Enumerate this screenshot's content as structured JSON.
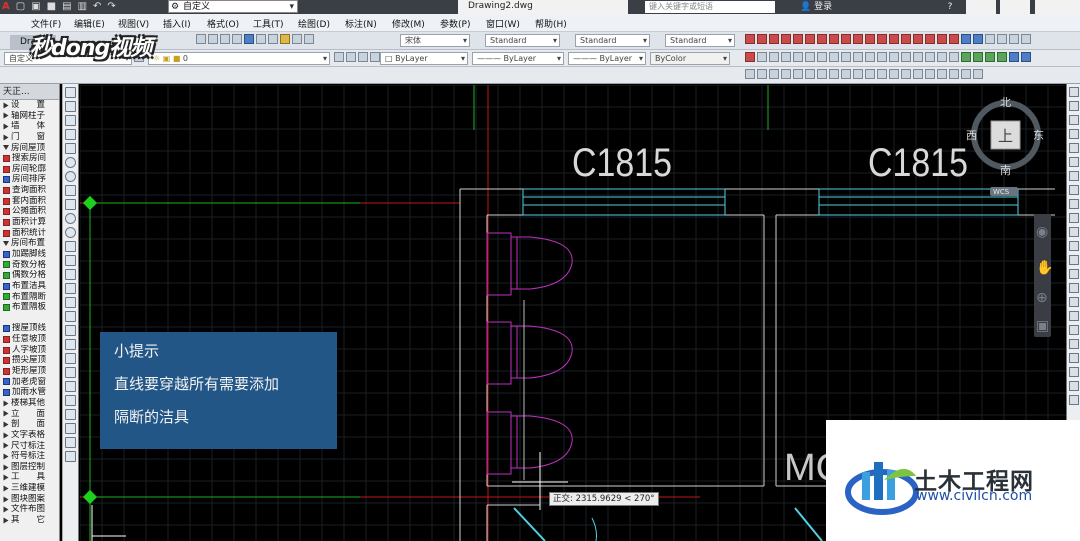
{
  "titlebar": {
    "workspace": "自定义",
    "filename": "Drawing2.dwg",
    "search_placeholder": "键入关键字或短语",
    "login": "登录",
    "help": "?"
  },
  "menu": [
    {
      "label": "文件(F)"
    },
    {
      "label": "编辑(E)"
    },
    {
      "label": "视图(V)"
    },
    {
      "label": "插入(I)"
    },
    {
      "label": "格式(O)"
    },
    {
      "label": "工具(T)"
    },
    {
      "label": "绘图(D)"
    },
    {
      "label": "标注(N)"
    },
    {
      "label": "修改(M)"
    },
    {
      "label": "参数(P)"
    },
    {
      "label": "窗口(W)"
    },
    {
      "label": "帮助(H)"
    }
  ],
  "doc_tab": "Draw",
  "logo_text": "秒dong视频",
  "toolbar": {
    "text_style_font": "宋体",
    "text_style": "Standard",
    "dim_style": "Standard",
    "table_style": "Standard",
    "workspace_combo": "自定义",
    "layer_value": "0",
    "color": "ByLayer",
    "linetype": "ByLayer",
    "lineweight": "ByLayer",
    "plotstyle": "ByColor"
  },
  "palette": {
    "title": "天正...",
    "items": [
      {
        "label": "设　　置",
        "icon": "triangle"
      },
      {
        "label": "轴网柱子",
        "icon": "triangle"
      },
      {
        "label": "墙　　体",
        "icon": "triangle"
      },
      {
        "label": "门　　窗",
        "icon": "triangle"
      },
      {
        "label": "房间屋顶",
        "icon": "triangle-open"
      },
      {
        "label": "搜索房间",
        "icon": "red"
      },
      {
        "label": "房间轮廓",
        "icon": "red"
      },
      {
        "label": "房间排序",
        "icon": "blue"
      },
      {
        "label": "查询面积",
        "icon": "red"
      },
      {
        "label": "套内面积",
        "icon": "red"
      },
      {
        "label": "公摊面积",
        "icon": "red"
      },
      {
        "label": "面积计算",
        "icon": "red"
      },
      {
        "label": "面积统计",
        "icon": "red"
      },
      {
        "label": "房间布置",
        "icon": "triangle-open"
      },
      {
        "label": "加踢脚线",
        "icon": "blue"
      },
      {
        "label": "奇数分格",
        "icon": "grn"
      },
      {
        "label": "偶数分格",
        "icon": "grn"
      },
      {
        "label": "布置洁具",
        "icon": "blue"
      },
      {
        "label": "布置隔断",
        "icon": "grn"
      },
      {
        "label": "布置隔板",
        "icon": "grn"
      },
      {
        "label": "",
        "icon": "none"
      },
      {
        "label": "搜屋顶线",
        "icon": "blue"
      },
      {
        "label": "任意坡顶",
        "icon": "red"
      },
      {
        "label": "人字坡顶",
        "icon": "red"
      },
      {
        "label": "攒尖屋顶",
        "icon": "red"
      },
      {
        "label": "矩形屋顶",
        "icon": "red"
      },
      {
        "label": "加老虎窗",
        "icon": "blue"
      },
      {
        "label": "加雨水管",
        "icon": "blue"
      },
      {
        "label": "楼梯其他",
        "icon": "triangle"
      },
      {
        "label": "立　　面",
        "icon": "triangle"
      },
      {
        "label": "剖　　面",
        "icon": "triangle"
      },
      {
        "label": "文字表格",
        "icon": "triangle"
      },
      {
        "label": "尺寸标注",
        "icon": "triangle"
      },
      {
        "label": "符号标注",
        "icon": "triangle"
      },
      {
        "label": "图层控制",
        "icon": "triangle"
      },
      {
        "label": "工　　具",
        "icon": "triangle"
      },
      {
        "label": "三维建模",
        "icon": "triangle"
      },
      {
        "label": "图块图案",
        "icon": "triangle"
      },
      {
        "label": "文件布图",
        "icon": "triangle"
      },
      {
        "label": "其　　它",
        "icon": "triangle"
      }
    ]
  },
  "drawing": {
    "window_labels": [
      "C1815",
      "C1815"
    ],
    "partial_label": "MC",
    "wcs": "WCS"
  },
  "viewcube": {
    "north": "北",
    "south": "南",
    "east": "东",
    "west": "西",
    "face": "上"
  },
  "tip": {
    "title": "小提示",
    "line1": "直线要穿越所有需要添加",
    "line2": "隔断的洁具"
  },
  "ortho_tooltip": "正交: 2315.9629 < 270°",
  "watermark": {
    "title": "土木工程网",
    "url": "www.civilcn.com"
  },
  "colors": {
    "canvas": "#000000",
    "wall": "#ffffff",
    "window_cyan": "#4fd0e0",
    "fixture_magenta": "#c030c0",
    "grid_red": "#d02020",
    "grid_green": "#20c020",
    "tip_bg": "#245b8f"
  }
}
